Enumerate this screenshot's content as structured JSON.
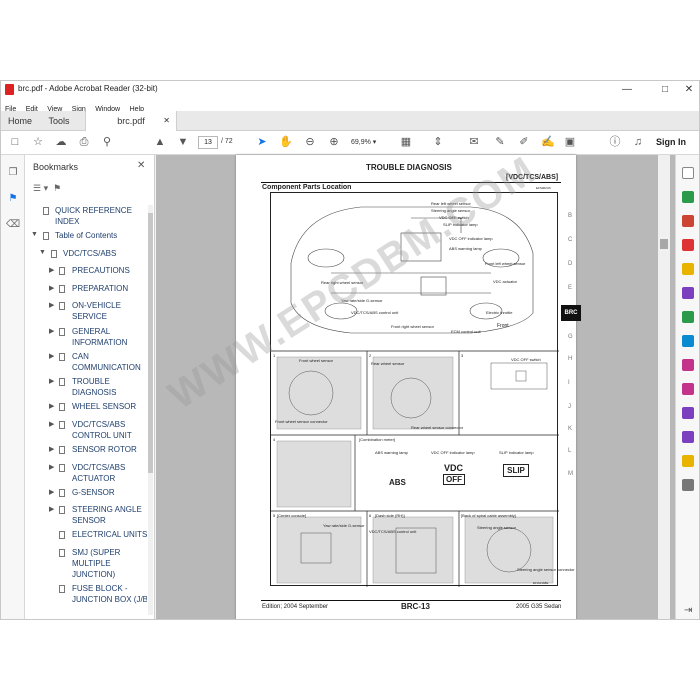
{
  "window": {
    "title": "brc.pdf - Adobe Acrobat Reader (32-bit)"
  },
  "menu": [
    "File",
    "Edit",
    "View",
    "Sign",
    "Window",
    "Help"
  ],
  "tabs": {
    "home": "Home",
    "tools": "Tools",
    "document": "brc.pdf"
  },
  "toolbar": {
    "page_current": "13",
    "page_total": "/ 72",
    "zoom": "69,9%",
    "sign_in": "Sign In"
  },
  "bookmarks": {
    "title": "Bookmarks",
    "items": [
      {
        "label": "QUICK REFERENCE INDEX"
      },
      {
        "label": "Table of Contents"
      },
      {
        "label": "VDC/TCS/ABS"
      },
      {
        "label": "PRECAUTIONS"
      },
      {
        "label": "PREPARATION"
      },
      {
        "label": "ON-VEHICLE SERVICE"
      },
      {
        "label": "GENERAL INFORMATION"
      },
      {
        "label": "CAN COMMUNICATION"
      },
      {
        "label": "TROUBLE DIAGNOSIS"
      },
      {
        "label": "WHEEL SENSOR"
      },
      {
        "label": "VDC/TCS/ABS CONTROL UNIT"
      },
      {
        "label": "SENSOR ROTOR"
      },
      {
        "label": "VDC/TCS/ABS ACTUATOR"
      },
      {
        "label": "G-SENSOR"
      },
      {
        "label": "STEERING ANGLE SENSOR"
      },
      {
        "label": "ELECTRICAL UNITS"
      },
      {
        "label": "SMJ (SUPER MULTIPLE JUNCTION)"
      },
      {
        "label": "FUSE BLOCK - JUNCTION BOX (J/B)"
      }
    ]
  },
  "pdf_page": {
    "heading": "TROUBLE DIAGNOSIS",
    "subheading": "[VDC/TCS/ABS]",
    "section": "Component Parts Location",
    "ref": "EFS002U6",
    "side_letters": [
      "B",
      "C",
      "D",
      "E",
      "BRC",
      "G",
      "H",
      "I",
      "J",
      "K",
      "L",
      "M"
    ],
    "footer_left": "Edition; 2004 September",
    "footer_center": "BRC-13",
    "footer_right": "2005 G35 Sedan",
    "labels": {
      "rear_left": "Rear left wheel sensor",
      "steering": "Steering angle sensor",
      "vdc_off_sw": "VDC OFF switch",
      "slip_lamp": "SLIP indicator lamp",
      "vdc_off_lamp": "VDC OFF indicator lamp",
      "abs_lamp": "ABS warning lamp",
      "front_left": "Front left wheel sensor",
      "vdc_act": "VDC actuator",
      "rear_right": "Rear right wheel sensor",
      "yaw": "Yaw rate/side G-sensor",
      "ctrl_unit": "VDC/TCS/ABS control unit",
      "front_right": "Front right wheel sensor",
      "ecm": "ECM control unit",
      "throttle": "Electric throttle",
      "front": "Front",
      "front_wheel": "Front wheel sensor",
      "front_conn": "Front wheel sensor connector",
      "rear_wheel": "Rear wheel sensor",
      "rear_conn": "Rear wheel sensor connector",
      "vdc_off_sw2": "VDC OFF switch",
      "combo": "[Combination meter]",
      "abs_warn": "ABS warning lamp",
      "vdc_off_ind": "VDC OFF indicator lamp",
      "slip_ind": "SLIP indicator lamp",
      "abs_text": "ABS",
      "vdc_text": "VDC",
      "off_text": "OFF",
      "slip_text": "SLIP",
      "center_console": "[Center console]",
      "yaw2": "Yaw rate/side G-sensor",
      "dash_side": "[Dash side (RH)]",
      "ctrl2": "VDC/TCS/ABS control unit",
      "spiral": "[Back of spiral cable assembly]",
      "steering2": "Steering angle sensor",
      "steer_conn": "Steering angle sensor connector",
      "n1": "1",
      "n2": "2",
      "n3": "3",
      "n4": "4",
      "n5": "5",
      "n6": "6",
      "code": "EFIA0168E"
    },
    "watermark": "WWW.EPCDBM.COM"
  }
}
